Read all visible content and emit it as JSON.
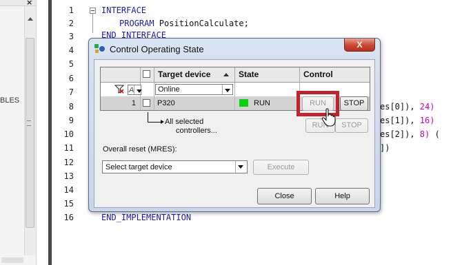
{
  "left_pane": {
    "close_glyph": "×",
    "fragment_text": "BLES"
  },
  "editor": {
    "line_numbers": [
      "1",
      "2",
      "3",
      "4",
      "5",
      "6",
      "7",
      "8",
      "9",
      "10",
      "11",
      "12",
      "13",
      "14",
      "15",
      "16"
    ],
    "lines": {
      "l1": "INTERFACE",
      "l2_kw": "PROGRAM",
      "l2_rest": " PositionCalculate;",
      "l3": "END_INTERFACE",
      "l8_a": "es[0]), ",
      "l8_b": "24)",
      "l9_a": "es[1]), ",
      "l9_b": "16)",
      "l10_a": "es[2]), ",
      "l10_b": "8)",
      "l10_c": " (",
      "l11": "])",
      "l16": "END_IMPLEMENTATION"
    }
  },
  "dialog": {
    "title": "Control Operating State",
    "close_glyph": "X",
    "table": {
      "columns": {
        "target": "Target device",
        "state": "State",
        "control": "Control"
      },
      "filter_row": {
        "op_value": "A",
        "target_filter": "Online"
      },
      "rows": [
        {
          "index": "1",
          "device": "P320",
          "state": "RUN",
          "run_label": "RUN",
          "stop_label": "STOP"
        }
      ]
    },
    "all_selected": {
      "line1": "All selected",
      "line2": "controllers...",
      "run_label": "RUN",
      "stop_label": "STOP"
    },
    "overall_reset": {
      "label": "Overall reset (MRES):",
      "select_value": "Select target device",
      "execute_label": "Execute"
    },
    "footer": {
      "close_label": "Close",
      "help_label": "Help"
    },
    "colors": {
      "highlight": "#c4212f",
      "state_online": "#0ed00e",
      "close_btn": "#c8452f"
    }
  }
}
